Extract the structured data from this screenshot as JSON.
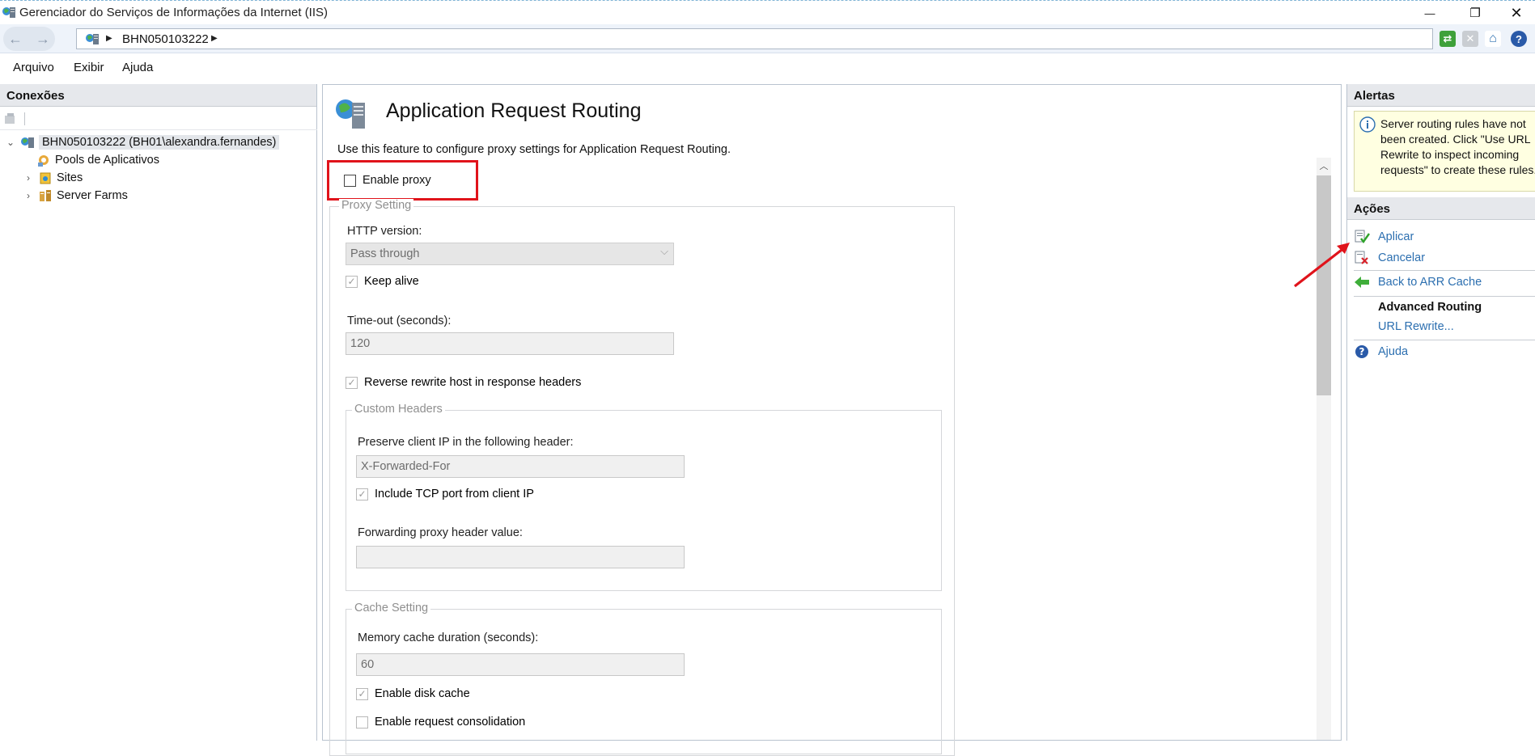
{
  "window": {
    "title": "Gerenciador do Serviços de Informações da Internet (IIS)",
    "minimize_glyph": "—",
    "restore_glyph": "❐",
    "close_glyph": "✕"
  },
  "address_bar": {
    "back_glyph": "←",
    "forward_glyph": "→",
    "crumb_arrow": "▶",
    "server": "BHN050103222",
    "toolbar_icons": [
      "refresh-icon",
      "stop-icon",
      "home-icon",
      "help-icon"
    ]
  },
  "menu": {
    "items": [
      "Arquivo",
      "Exibir",
      "Ajuda"
    ]
  },
  "connections": {
    "header": "Conexões",
    "tree": {
      "root": "BHN050103222 (BH01\\alexandra.fernandes)",
      "children": [
        "Pools de Aplicativos",
        "Sites",
        "Server Farms"
      ]
    }
  },
  "feature": {
    "title": "Application Request Routing",
    "description": "Use this feature to configure proxy settings for Application Request Routing.",
    "enable_proxy_label": "Enable proxy",
    "enable_proxy_checked": false,
    "proxy_setting": {
      "group_label": "Proxy Setting",
      "http_version_label": "HTTP version:",
      "http_version_value": "Pass through",
      "keep_alive_label": "Keep alive",
      "timeout_label": "Time-out (seconds):",
      "timeout_value": "120",
      "reverse_rewrite_label": "Reverse rewrite host in response headers"
    },
    "custom_headers": {
      "group_label": "Custom Headers",
      "preserve_ip_label": "Preserve client IP in the following header:",
      "preserve_ip_value": "X-Forwarded-For",
      "include_tcp_label": "Include TCP port from client IP",
      "forwarding_header_label": "Forwarding proxy header value:",
      "forwarding_header_value": ""
    },
    "cache_setting": {
      "group_label": "Cache Setting",
      "memory_cache_label": "Memory cache duration (seconds):",
      "memory_cache_value": "60",
      "enable_disk_cache_label": "Enable disk cache",
      "enable_request_consolidation_label": "Enable request consolidation"
    }
  },
  "alerts": {
    "header": "Alertas",
    "message": "Server routing rules have not been created. Click \"Use URL Rewrite to inspect incoming requests\" to create these rules."
  },
  "actions": {
    "header": "Ações",
    "apply": "Aplicar",
    "cancel": "Cancelar",
    "back": "Back to ARR Cache",
    "advanced_routing_title": "Advanced Routing",
    "url_rewrite": "URL Rewrite...",
    "help": "Ajuda"
  },
  "colors": {
    "annotation_red": "#e0131b",
    "link_blue": "#2c6fb0",
    "alert_bg": "#ffffe1"
  }
}
